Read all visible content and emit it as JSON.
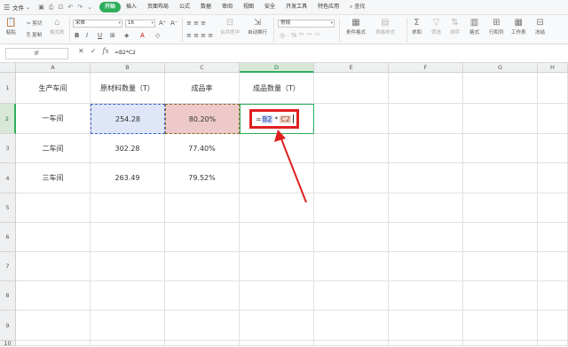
{
  "menubar": {
    "file_label": "文件",
    "tabs": [
      {
        "label": "开始",
        "active": true
      },
      {
        "label": "插入",
        "active": false
      },
      {
        "label": "页面布局",
        "active": false
      },
      {
        "label": "公式",
        "active": false
      },
      {
        "label": "数据",
        "active": false
      },
      {
        "label": "审阅",
        "active": false
      },
      {
        "label": "视图",
        "active": false
      },
      {
        "label": "安全",
        "active": false
      },
      {
        "label": "开发工具",
        "active": false
      },
      {
        "label": "特色应用",
        "active": false
      }
    ],
    "search_label": "查找"
  },
  "ribbon": {
    "cut": "剪切",
    "copy": "复制",
    "paste": "粘贴",
    "format_painter": "格式刷",
    "font_name": "宋体",
    "font_size": "16",
    "bold": "B",
    "italic": "I",
    "underline": "U",
    "merge_center": "合并居中",
    "auto_wrap": "自动换行",
    "number_format": "常规",
    "conditional_format": "条件格式",
    "table_style": "表格样式",
    "sum": "求和",
    "filter": "筛选",
    "sort": "排序",
    "format": "格式",
    "row_col": "行和列",
    "worksheet": "工作表",
    "freeze": "冻结"
  },
  "formula_bar": {
    "name_box": "IF",
    "cancel_icon": "✕",
    "confirm_icon": "✓",
    "fx_label": "fx",
    "formula": "=B2*C2"
  },
  "accent_green": "#2fae5b",
  "highlight_red": "#e02020",
  "sheet": {
    "columns": [
      "A",
      "B",
      "C",
      "D",
      "E",
      "F",
      "G",
      "H"
    ],
    "rows": [
      "1",
      "2",
      "3",
      "4",
      "5",
      "6",
      "7",
      "8",
      "9",
      "10"
    ],
    "headers": [
      "生产车间",
      "原材料数量（T）",
      "成品率",
      "成品数量（T）"
    ],
    "data": [
      [
        "一车间",
        "254.28",
        "80.20%",
        ""
      ],
      [
        "二车间",
        "302.28",
        "77.40%",
        ""
      ],
      [
        "三车间",
        "263.49",
        "79.52%",
        ""
      ]
    ],
    "editing": {
      "prefix": "=",
      "ref1": "B2",
      "operator": "*",
      "ref2": "C2"
    }
  }
}
